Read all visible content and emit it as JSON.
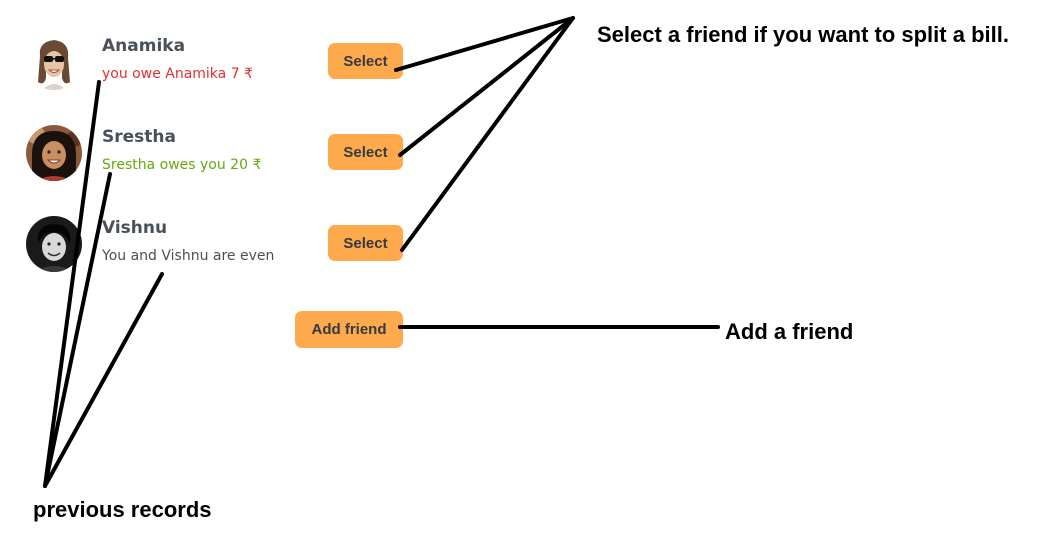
{
  "friends": [
    {
      "name": "Anamika",
      "balance": "you owe Anamika 7 ₹",
      "balance_color": "#e03131",
      "select_label": "Select",
      "avatar_icon": "avatar-anamika"
    },
    {
      "name": "Srestha",
      "balance": "Srestha owes you 20 ₹",
      "balance_color": "#66a80f",
      "select_label": "Select",
      "avatar_icon": "avatar-srestha"
    },
    {
      "name": "Vishnu",
      "balance": "You and Vishnu are even",
      "balance_color": "#495057",
      "select_label": "Select",
      "avatar_icon": "avatar-vishnu"
    }
  ],
  "add_friend_label": "Add friend",
  "annotations": {
    "select": "Select a friend if you want to split a bill.",
    "add": "Add a friend",
    "previous": "previous records"
  },
  "colors": {
    "button": "#ffa94d",
    "button_text": "#343a40",
    "name_text": "#495057"
  }
}
